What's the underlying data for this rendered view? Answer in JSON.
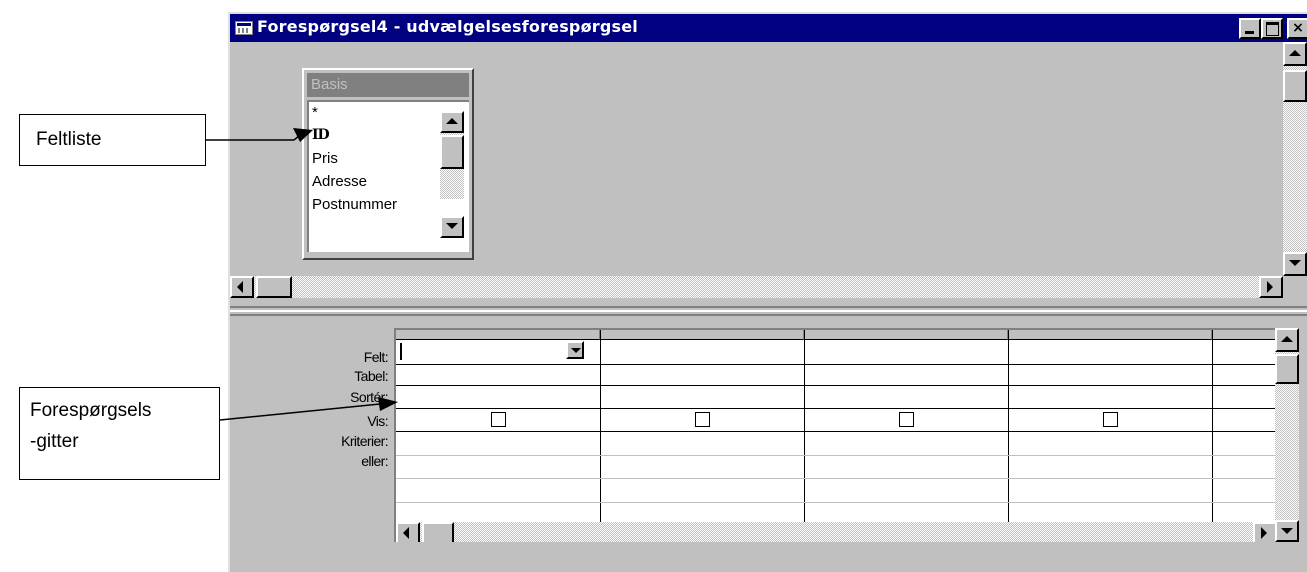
{
  "window": {
    "title": "Forespørgsel4 - udvælgelsesforespørgsel",
    "buttons": {
      "minimize": "",
      "maximize": "",
      "close": "×"
    }
  },
  "field_list": {
    "title": "Basis",
    "items": [
      "*",
      "ID",
      "Pris",
      "Adresse",
      "Postnummer"
    ]
  },
  "query_grid": {
    "row_labels": [
      "Felt:",
      "Tabel:",
      "Sortér:",
      "Vis:",
      "Kriterier:",
      "eller:"
    ],
    "columns": [
      {
        "felt": "",
        "tabel": "",
        "sort": "",
        "vis": false,
        "kriterier": "",
        "eller": ""
      },
      {
        "felt": "",
        "tabel": "",
        "sort": "",
        "vis": false,
        "kriterier": "",
        "eller": ""
      },
      {
        "felt": "",
        "tabel": "",
        "sort": "",
        "vis": false,
        "kriterier": "",
        "eller": ""
      },
      {
        "felt": "",
        "tabel": "",
        "sort": "",
        "vis": false,
        "kriterier": "",
        "eller": ""
      },
      {
        "felt": "",
        "tabel": "",
        "sort": "",
        "vis": false,
        "kriterier": "",
        "eller": ""
      }
    ]
  },
  "callouts": {
    "field_list": "Feltliste",
    "grid_line1": "Forespørgsels",
    "grid_line2": "-gitter"
  }
}
